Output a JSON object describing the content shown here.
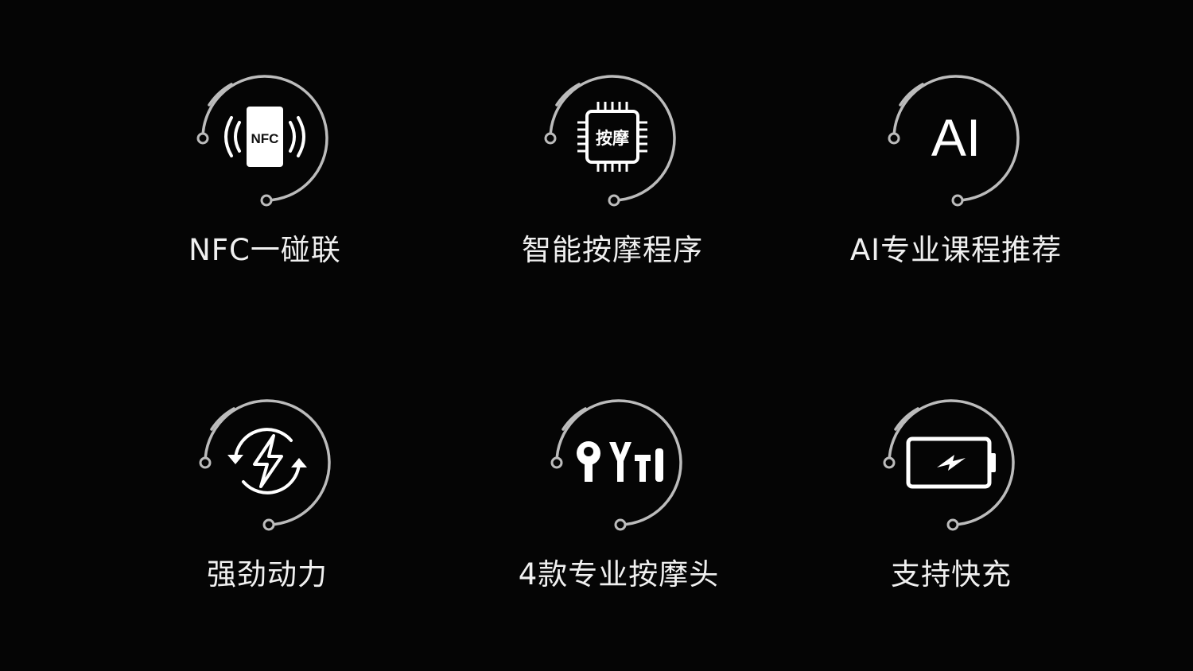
{
  "features": [
    {
      "id": "nfc",
      "label": "NFC一碰联",
      "icon": "nfc-phone-icon",
      "icon_text": "NFC"
    },
    {
      "id": "program",
      "label": "智能按摩程序",
      "icon": "chip-icon",
      "icon_text": "按摩"
    },
    {
      "id": "ai",
      "label": "AI专业课程推荐",
      "icon": "ai-icon",
      "icon_text": "AI"
    },
    {
      "id": "power",
      "label": "强劲动力",
      "icon": "lightning-cycle-icon"
    },
    {
      "id": "heads",
      "label": "4款专业按摩头",
      "icon": "massage-heads-icon"
    },
    {
      "id": "charge",
      "label": "支持快充",
      "icon": "battery-charge-icon"
    }
  ],
  "colors": {
    "background": "#050505",
    "ring": "#bcbcbc",
    "text": "#f0f0f0"
  }
}
